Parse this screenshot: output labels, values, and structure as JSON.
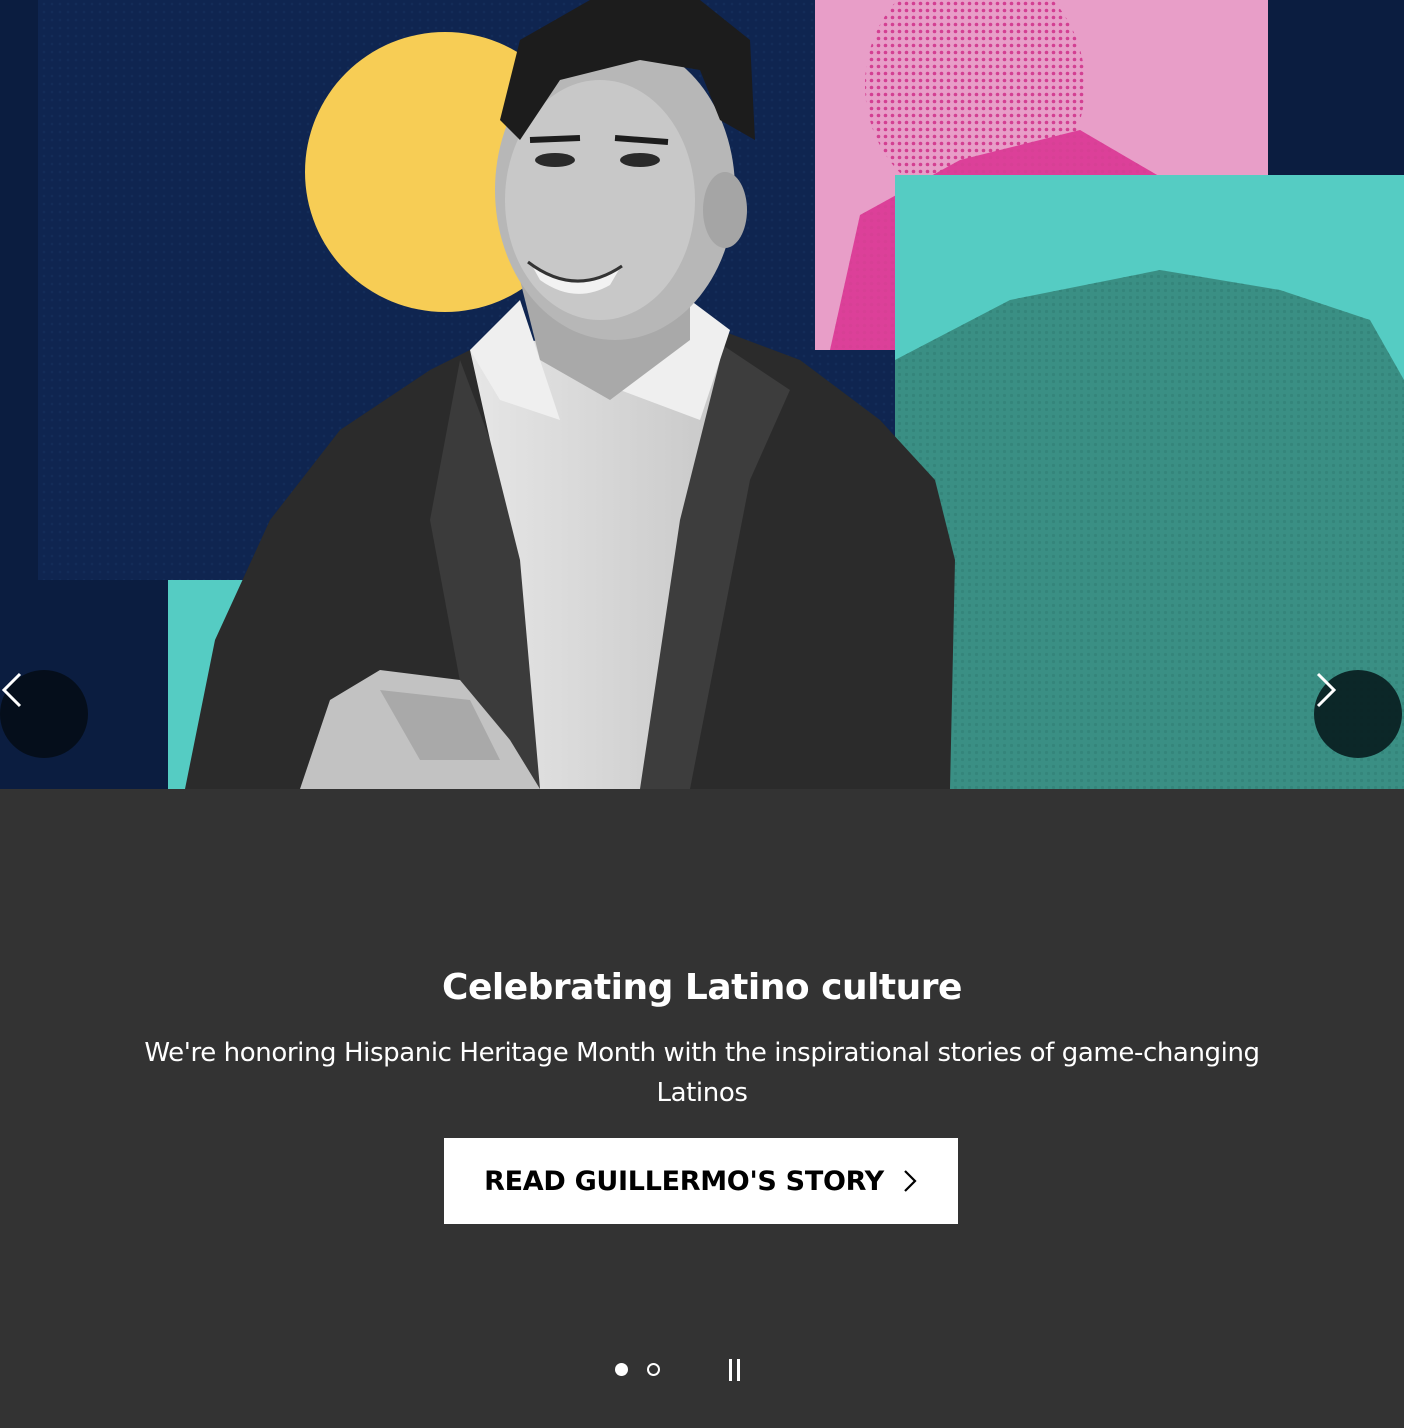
{
  "hero": {
    "image_description_name": "hero-image",
    "palette": {
      "navy": "#0d2045",
      "dark_navy": "#0a1a38",
      "yellow": "#f7cd55",
      "pink_light": "#e89ec8",
      "pink_hot": "#dc3b97",
      "teal": "#55ccc3",
      "teal_dark": "#3a8f84"
    }
  },
  "carousel": {
    "prev_icon": "chevron-left-icon",
    "next_icon": "chevron-right-icon",
    "slide_count": 2,
    "active_slide": 1
  },
  "slide": {
    "title": "Celebrating Latino culture",
    "subtitle": "We're honoring Hispanic Heritage Month with the inspirational stories of game-changing Latinos",
    "cta_label": "READ GUILLERMO'S STORY",
    "cta_icon": "chevron-right-icon"
  },
  "colors": {
    "caption_bg": "#333333",
    "text": "#ffffff",
    "button_bg": "#ffffff",
    "button_text": "#000000"
  }
}
